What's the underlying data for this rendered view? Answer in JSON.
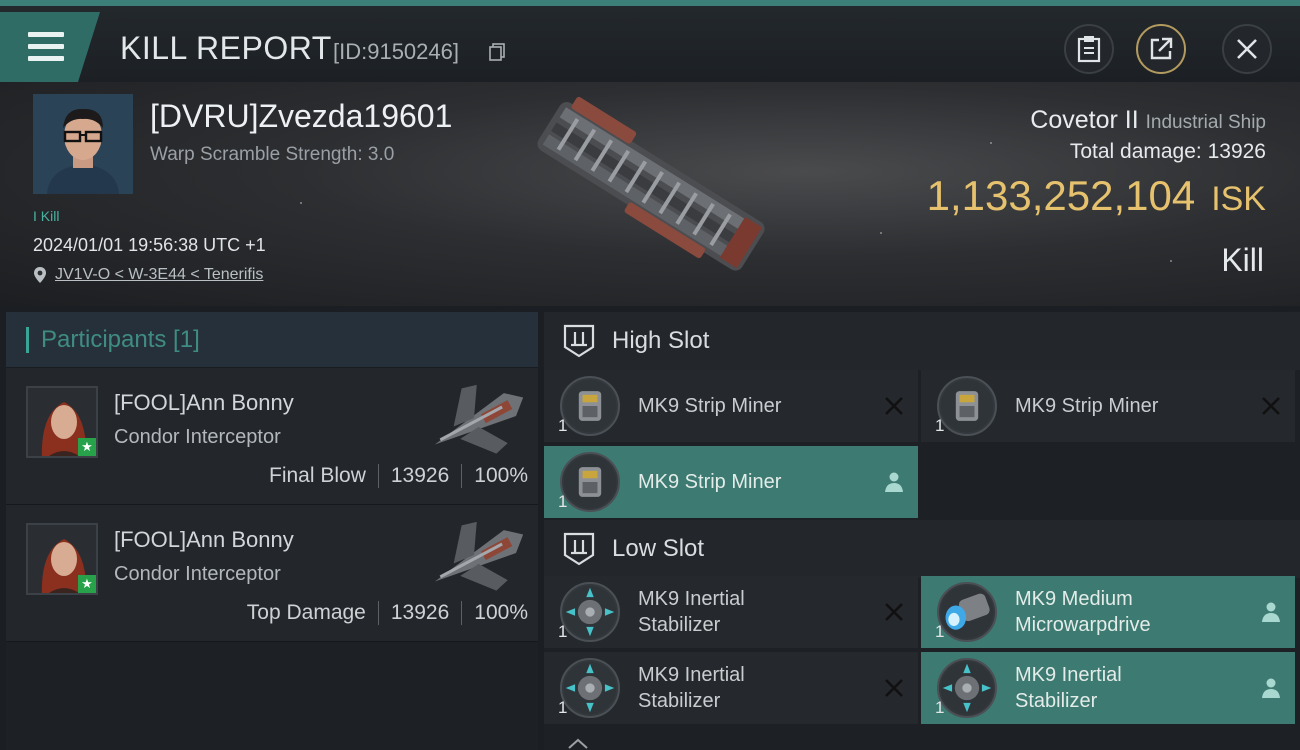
{
  "header": {
    "title": "KILL REPORT",
    "report_id": "[ID:9150246]"
  },
  "victim": {
    "name": "[DVRU]Zvezda19601",
    "warp_scramble": "Warp Scramble Strength: 3.0",
    "kill_badge": "I Kill",
    "datetime": "2024/01/01 19:56:38 UTC +1",
    "location": "JV1V-O < W-3E44 < Tenerifis"
  },
  "ship": {
    "name": "Covetor II",
    "class": "Industrial Ship",
    "total_damage_label": "Total damage:",
    "total_damage_value": "13926",
    "isk_value": "1,133,252,104",
    "isk_unit": "ISK",
    "result": "Kill"
  },
  "participants": {
    "header": "Participants [1]",
    "rows": [
      {
        "name": "[FOOL]Ann Bonny",
        "ship": "Condor Interceptor",
        "role": "Final Blow",
        "damage": "13926",
        "percent": "100%"
      },
      {
        "name": "[FOOL]Ann Bonny",
        "ship": "Condor Interceptor",
        "role": "Top Damage",
        "damage": "13926",
        "percent": "100%"
      }
    ]
  },
  "fitting": {
    "high_slot": {
      "label": "High Slot",
      "modules": [
        {
          "name": "MK9 Strip Miner",
          "qty": "1",
          "status": "destroyed"
        },
        {
          "name": "MK9 Strip Miner",
          "qty": "1",
          "status": "destroyed"
        },
        {
          "name": "MK9 Strip Miner",
          "qty": "1",
          "status": "dropped"
        }
      ]
    },
    "low_slot": {
      "label": "Low Slot",
      "modules": [
        {
          "name": "MK9 Inertial\nStabilizer",
          "qty": "1",
          "status": "destroyed"
        },
        {
          "name": "MK9 Medium\nMicrowarpdrive",
          "qty": "1",
          "status": "dropped"
        },
        {
          "name": "MK9 Inertial\nStabilizer",
          "qty": "1",
          "status": "destroyed"
        },
        {
          "name": "MK9 Inertial\nStabilizer",
          "qty": "1",
          "status": "dropped"
        }
      ]
    }
  },
  "colors": {
    "accent": "#3d7a71",
    "isk": "#e6c26e",
    "teal_text": "#3f8c83"
  }
}
